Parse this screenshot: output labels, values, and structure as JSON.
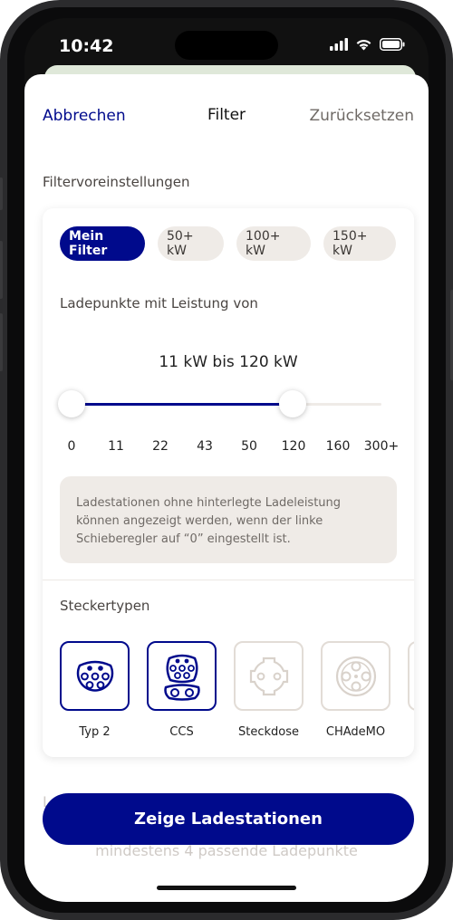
{
  "status": {
    "time": "10:42"
  },
  "nav": {
    "cancel": "Abbrechen",
    "title": "Filter",
    "reset": "Zurücksetzen"
  },
  "presets": {
    "section_label": "Filtervoreinstellungen",
    "chips": [
      {
        "label": "Mein Filter",
        "active": true
      },
      {
        "label": "50+ kW",
        "active": false
      },
      {
        "label": "100+ kW",
        "active": false
      },
      {
        "label": "150+ kW",
        "active": false
      }
    ]
  },
  "power": {
    "heading": "Ladepunkte mit Leistung von",
    "range_text": "11 kW bis 120 kW",
    "min_index": 0,
    "max_index": 5,
    "ticks": [
      "0",
      "11",
      "22",
      "43",
      "50",
      "120",
      "160",
      "300+"
    ],
    "info": "Ladestationen ohne hinterlegte Ladeleistung können angezeigt werden, wenn der linke Schieberegler auf “0” eingestellt ist."
  },
  "plugs": {
    "heading": "Steckertypen",
    "items": [
      {
        "label": "Typ 2",
        "selected": true,
        "icon": "type2-plug-icon"
      },
      {
        "label": "CCS",
        "selected": true,
        "icon": "ccs-plug-icon"
      },
      {
        "label": "Steckdose",
        "selected": false,
        "icon": "socket-plug-icon"
      },
      {
        "label": "CHAdeMO",
        "selected": false,
        "icon": "chademo-plug-icon"
      }
    ]
  },
  "footer": {
    "cta": "Zeige Ladestationen",
    "behind_text": "mindestens 4 passende Ladepunkte",
    "behind_label": "L"
  },
  "colors": {
    "accent": "#000a8c",
    "chip_bg": "#efebe7",
    "muted": "#6f6a66"
  }
}
